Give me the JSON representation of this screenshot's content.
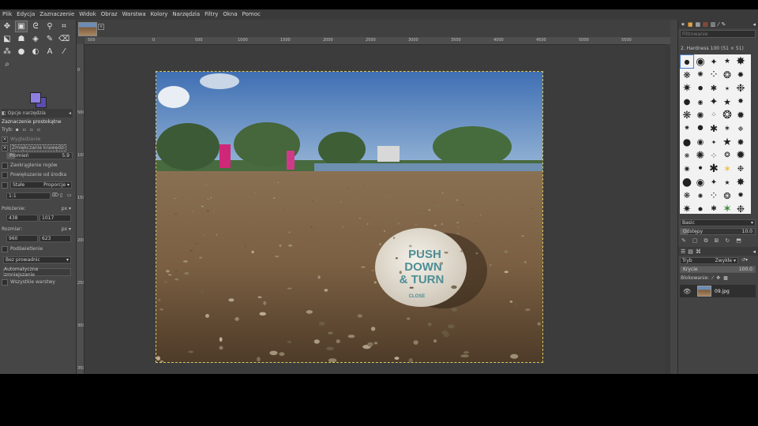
{
  "menubar": {
    "items": [
      "Plik",
      "Edycja",
      "Zaznaczenie",
      "Widok",
      "Obraz",
      "Warstwa",
      "Kolory",
      "Narzędzia",
      "Filtry",
      "Okna",
      "Pomoc"
    ]
  },
  "colors": {
    "foreground": "#8c7fe0",
    "background": "#5b4cb0",
    "selection_border": "#d8c760"
  },
  "tool_options": {
    "panel_title": "Opcje narzędzia",
    "tool_name": "Zaznaczenie prostokątne",
    "mode_label": "Tryb:",
    "antialias_label": "Wygładzanie",
    "feather_label": "Zmiękczanie krawędzi",
    "radius_label": "Promień",
    "radius_value": "5.9",
    "radius_fraction": 0.12,
    "rounded_label": "Zaokrąglenie rogów",
    "expand_label": "Powiększanie od środka",
    "fixed_label": "Stałe",
    "fixed_value": "Proporcje",
    "ratio_value": "1:1",
    "position_label": "Położenie:",
    "position_unit": "px",
    "position_x": "438",
    "position_y": "1017",
    "size_label": "Rozmiar:",
    "size_unit": "px",
    "size_w": "960",
    "size_h": "623",
    "highlight_label": "Podświetlenie",
    "guides_value": "Bez prowadnic",
    "auto_shrink_label": "Automatyczne zmniejszanie",
    "all_layers_label": "Wszystkie warstwy"
  },
  "rulers": {
    "top": [
      "500",
      "0",
      "500",
      "1000",
      "1500",
      "2000",
      "2500",
      "3000",
      "3500",
      "4000",
      "4500",
      "5000",
      "5500"
    ],
    "left": [
      "0",
      "500",
      "1000",
      "1500",
      "2000",
      "2500",
      "3000",
      "3500"
    ]
  },
  "brushes": {
    "filter_placeholder": "Filtrowanie",
    "selected_brush": "2. Hardness 100 (51 × 51)",
    "preset_value": "Basic",
    "spacing_label": "Odstępy",
    "spacing_value": "10.0",
    "spacing_fraction": 0.1
  },
  "layers": {
    "mode_label": "Tryb",
    "mode_value": "Zwykłe",
    "opacity_label": "Krycie",
    "opacity_value": "100.0",
    "opacity_fraction": 1.0,
    "lock_label": "Blokowanie:",
    "items": [
      {
        "name": "09.jpg",
        "visible": true
      }
    ]
  },
  "photo": {
    "cap_lines": [
      "PUSH",
      "DOWN",
      "& TURN"
    ],
    "cap_small": "CLOSE"
  },
  "icons": {
    "tools": [
      "move-icon",
      "rect-select-icon",
      "lasso-icon",
      "fuzzy-select-icon",
      "crop-icon",
      "transform-icon",
      "warp-icon",
      "bucket-fill-icon",
      "brush-icon",
      "eraser-icon",
      "clone-icon",
      "smudge-icon",
      "dodge-icon",
      "text-icon",
      "color-picker-icon",
      "zoom-icon"
    ]
  }
}
